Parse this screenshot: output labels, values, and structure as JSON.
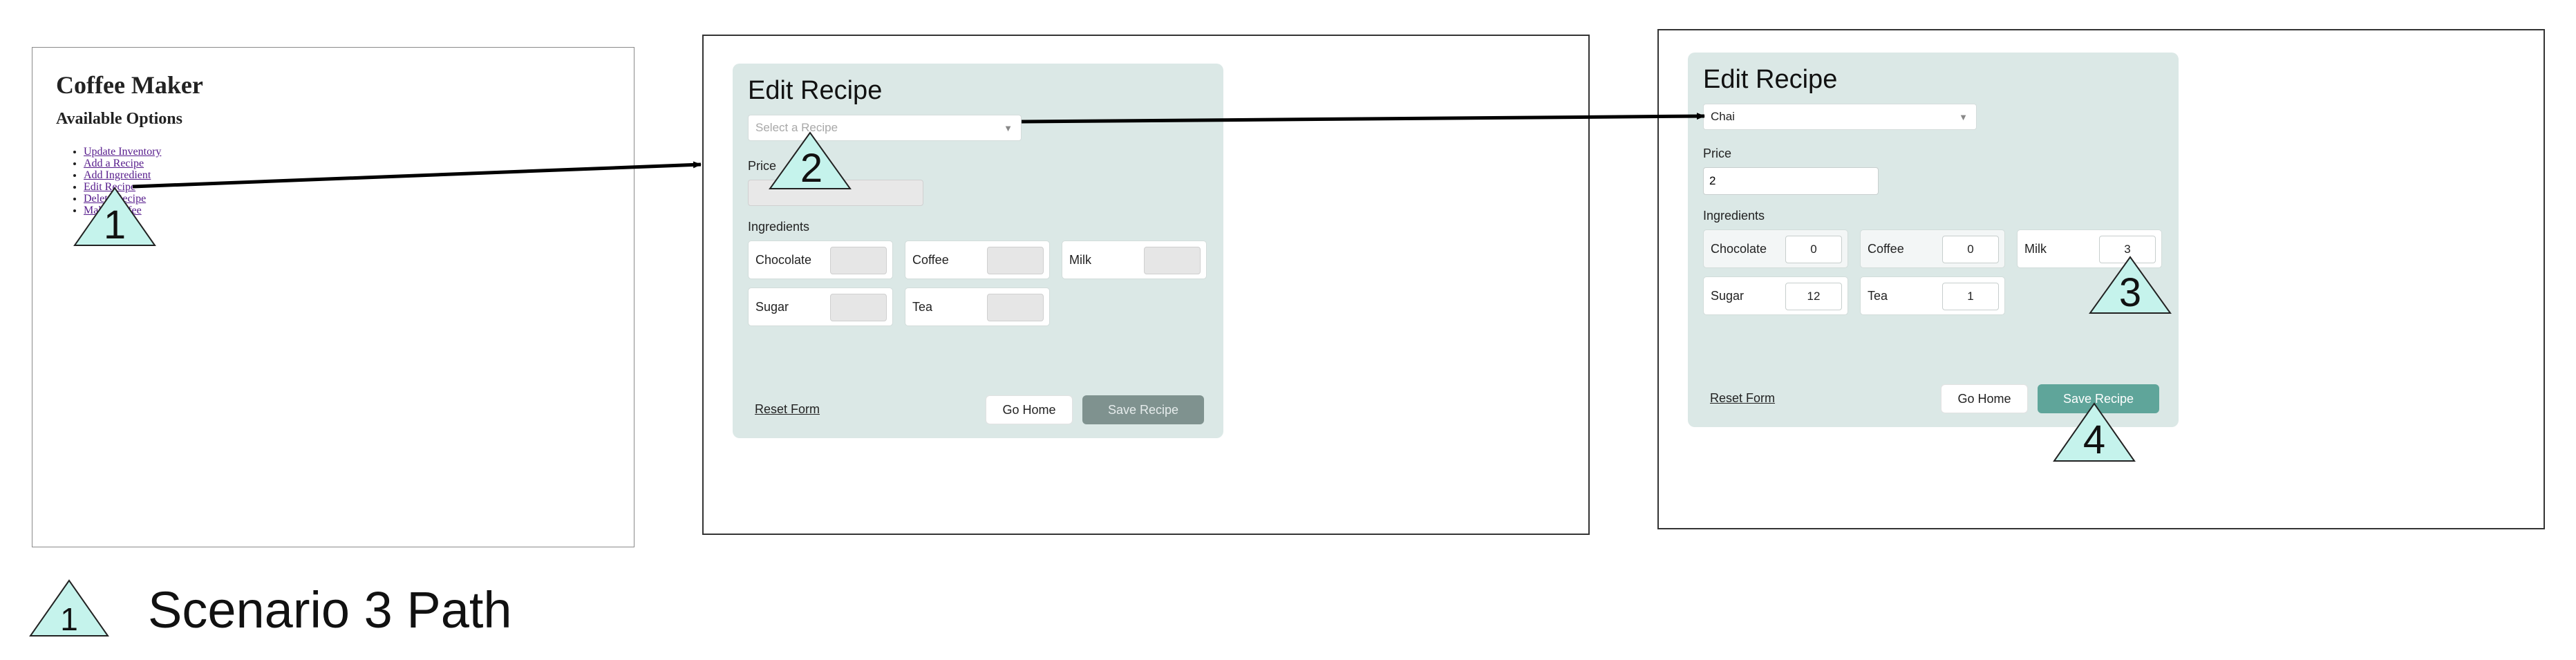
{
  "legend": {
    "marker": "1",
    "text": "Scenario 3 Path"
  },
  "steps": [
    "1",
    "2",
    "3",
    "4"
  ],
  "panel1": {
    "title": "Coffee Maker",
    "subtitle": "Available Options",
    "links": [
      "Update Inventory",
      "Add a Recipe",
      "Add Ingredient",
      "Edit Recipe",
      "Delete Recipe",
      "Make Coffee"
    ]
  },
  "panel2": {
    "title": "Edit Recipe",
    "select_placeholder": "Select a Recipe",
    "price_label": "Price",
    "ingredients_label": "Ingredients",
    "ingredients": [
      "Chocolate",
      "Coffee",
      "Milk",
      "Sugar",
      "Tea"
    ],
    "reset_label": "Reset Form",
    "home_label": "Go Home",
    "save_label": "Save Recipe"
  },
  "panel3": {
    "title": "Edit Recipe",
    "select_value": "Chai",
    "price_label": "Price",
    "price_value": "2",
    "ingredients_label": "Ingredients",
    "ingredients": [
      {
        "name": "Chocolate",
        "value": "0"
      },
      {
        "name": "Coffee",
        "value": "0"
      },
      {
        "name": "Milk",
        "value": "3"
      },
      {
        "name": "Sugar",
        "value": "12"
      },
      {
        "name": "Tea",
        "value": "1"
      }
    ],
    "reset_label": "Reset Form",
    "home_label": "Go Home",
    "save_label": "Save Recipe"
  },
  "colors": {
    "marker_fill": "#c5f3ec",
    "card_bg": "#dbe8e6",
    "save_active": "#5fa59a",
    "save_disabled": "#7f928f"
  }
}
